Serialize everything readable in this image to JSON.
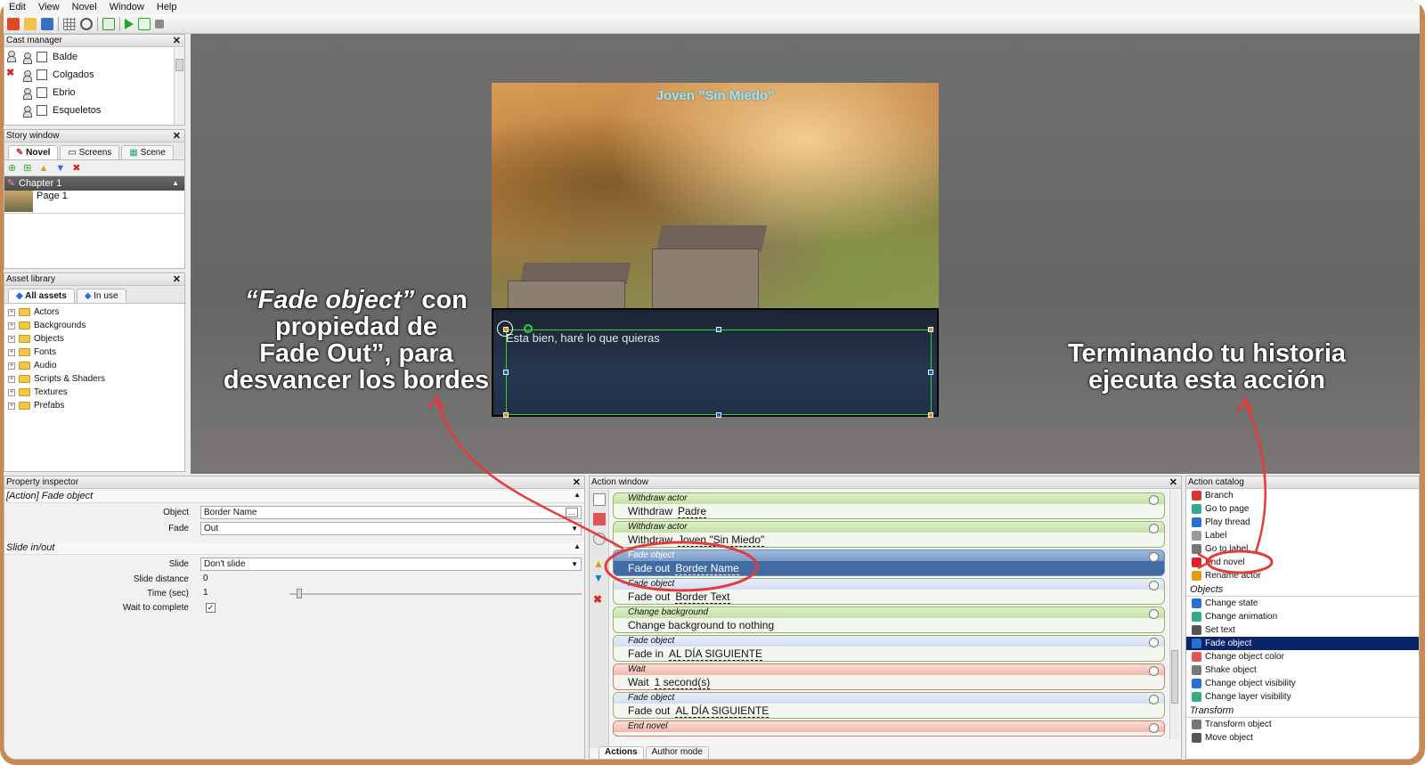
{
  "menu": [
    "Edit",
    "View",
    "Novel",
    "Window",
    "Help"
  ],
  "cast_manager": {
    "title": "Cast manager",
    "items": [
      "Balde",
      "Colgados",
      "Ebrio",
      "Esqueletos"
    ]
  },
  "story_window": {
    "title": "Story window",
    "tabs": [
      "Novel",
      "Screens",
      "Scene"
    ],
    "chapter": "Chapter 1",
    "page": "Page 1"
  },
  "asset_library": {
    "title": "Asset library",
    "tabs": [
      "All assets",
      "In use"
    ],
    "folders": [
      "Actors",
      "Backgrounds",
      "Objects",
      "Fonts",
      "Audio",
      "Scripts & Shaders",
      "Textures",
      "Prefabs"
    ]
  },
  "scene": {
    "speaker": "Joven \"Sin Miedo\"",
    "dialog": "Esta bien, haré lo que quieras"
  },
  "callouts": {
    "left_quote": "“Fade object”",
    "left_rest": " con\npropiedad de\nFade Out”, para\ndesvancer los bordes",
    "right": "Terminando tu historia\nejecuta esta acción"
  },
  "property_inspector": {
    "title": "Property inspector",
    "header": "[Action] Fade object",
    "fields": [
      {
        "label": "Object",
        "value": "Border Name"
      },
      {
        "label": "Fade",
        "value": "Out"
      }
    ],
    "section2": "Slide in/out",
    "fields2": [
      {
        "label": "Slide",
        "value": "Don't slide"
      },
      {
        "label": "Slide distance",
        "value": "0"
      },
      {
        "label": "Time (sec)",
        "value": "1"
      },
      {
        "label": "Wait to complete",
        "value": "✓"
      }
    ]
  },
  "action_window": {
    "title": "Action window",
    "actions": [
      {
        "title": "Withdraw actor",
        "body_pre": "Withdraw",
        "target": "Padre",
        "style": "green"
      },
      {
        "title": "Withdraw actor",
        "body_pre": "Withdraw",
        "target": "Joven \"Sin Miedo\"",
        "style": "green"
      },
      {
        "title": "Fade object",
        "body_pre": "Fade out",
        "target": "Border Name",
        "style": "sel"
      },
      {
        "title": "Fade object",
        "body_pre": "Fade out",
        "target": "Border Text",
        "style": "blue"
      },
      {
        "title": "Change background",
        "body_pre": "Change background to nothing",
        "target": "",
        "style": "green"
      },
      {
        "title": "Fade object",
        "body_pre": "Fade in",
        "target": "AL DÍA SIGUIENTE",
        "style": "blue"
      },
      {
        "title": "Wait",
        "body_pre": "Wait",
        "target": "1 second(s)",
        "style": "red"
      },
      {
        "title": "Fade object",
        "body_pre": "Fade out",
        "target": "AL DÍA SIGUIENTE",
        "style": "blue"
      },
      {
        "title": "End novel",
        "body_pre": "",
        "target": "",
        "style": "red"
      }
    ],
    "bottom_tabs": [
      "Actions",
      "Author mode"
    ]
  },
  "action_catalog": {
    "title": "Action catalog",
    "items_top": [
      "Branch",
      "Go to page",
      "Play thread",
      "Label",
      "Go to label",
      "End novel",
      "Rename actor"
    ],
    "section_objects": "Objects",
    "items_objects": [
      "Change state",
      "Change animation",
      "Set text",
      "Fade object",
      "Change object color",
      "Shake object",
      "Change object visibility",
      "Change layer visibility"
    ],
    "section_transform": "Transform",
    "items_transform": [
      "Transform object",
      "Move object"
    ]
  },
  "colors": {
    "frame": "#c88a55",
    "selection": "#0a246a",
    "annotation_red": "#e53a3a"
  }
}
